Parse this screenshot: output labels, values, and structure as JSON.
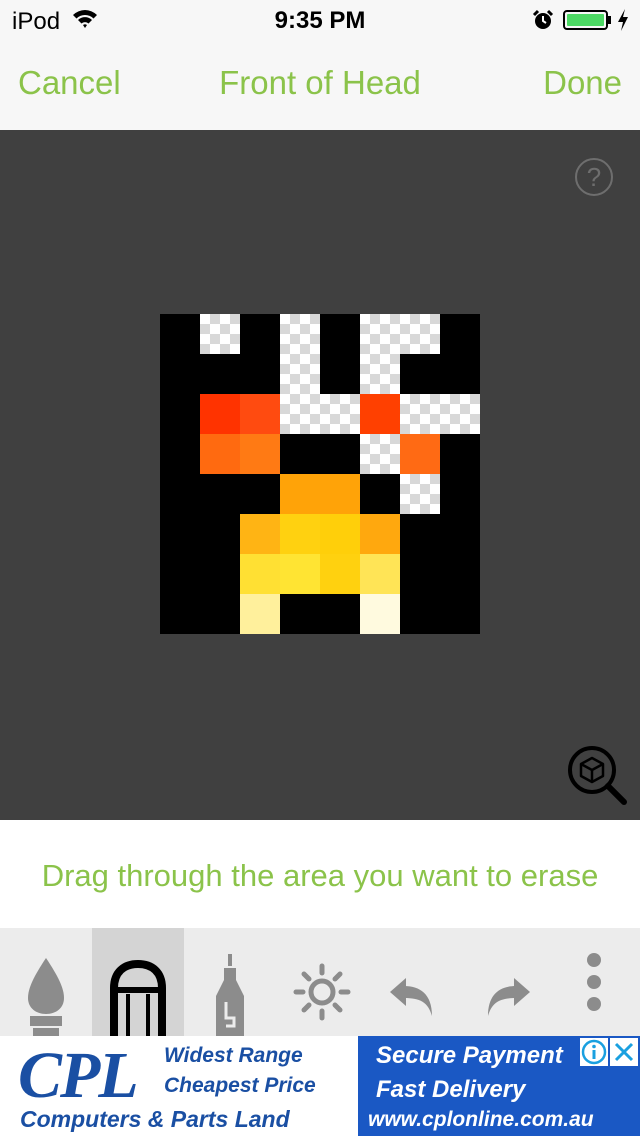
{
  "status_bar": {
    "carrier": "iPod",
    "time": "9:35 PM",
    "battery_color": "#4cd964"
  },
  "nav": {
    "cancel_label": "Cancel",
    "title": "Front of Head",
    "done_label": "Done"
  },
  "editor": {
    "help_label": "?",
    "grid": [
      [
        "#000000",
        "empty",
        "#000000",
        "empty",
        "#000000",
        "empty",
        "empty",
        "#000000"
      ],
      [
        "#000000",
        "#000000",
        "#000000",
        "empty",
        "#000000",
        "empty",
        "#000000",
        "#000000"
      ],
      [
        "#000000",
        "#ff3300",
        "#ff4b10",
        "empty",
        "empty",
        "#ff4000",
        "empty",
        "empty"
      ],
      [
        "#000000",
        "#ff6a10",
        "#ff7a14",
        "#000000",
        "#000000",
        "empty",
        "#ff6a14",
        "#000000"
      ],
      [
        "#000000",
        "#000000",
        "#000000",
        "#ffa308",
        "#ffa308",
        "#000000",
        "empty",
        "#000000"
      ],
      [
        "#000000",
        "#000000",
        "#ffb414",
        "#ffd110",
        "#ffcf0a",
        "#ffa80e",
        "#000000",
        "#000000"
      ],
      [
        "#000000",
        "#000000",
        "#ffe033",
        "#ffe433",
        "#ffd10f",
        "#ffe456",
        "#000000",
        "#000000"
      ],
      [
        "#000000",
        "#000000",
        "#fff09c",
        "#000000",
        "#000000",
        "#fffadf",
        "#000000",
        "#000000"
      ]
    ]
  },
  "hint": {
    "text": "Drag through the area you want to erase"
  },
  "toolbar": {
    "tools": [
      "brush-icon",
      "eraser-icon",
      "dropper-icon",
      "brightness-icon",
      "undo-icon",
      "redo-icon",
      "more-icon"
    ],
    "selected": "eraser-icon"
  },
  "ad": {
    "logo": "CPL",
    "line1": "Widest Range",
    "line2": "Cheapest Price",
    "line3": "Computers & Parts Land",
    "right_line1": "Secure Payment",
    "right_line2": "Fast Delivery",
    "right_line3": "www.cplonline.com.au"
  },
  "colors": {
    "accent": "#8bc34a",
    "canvas_background": "#404040",
    "ad_blue": "#1a58c4"
  }
}
